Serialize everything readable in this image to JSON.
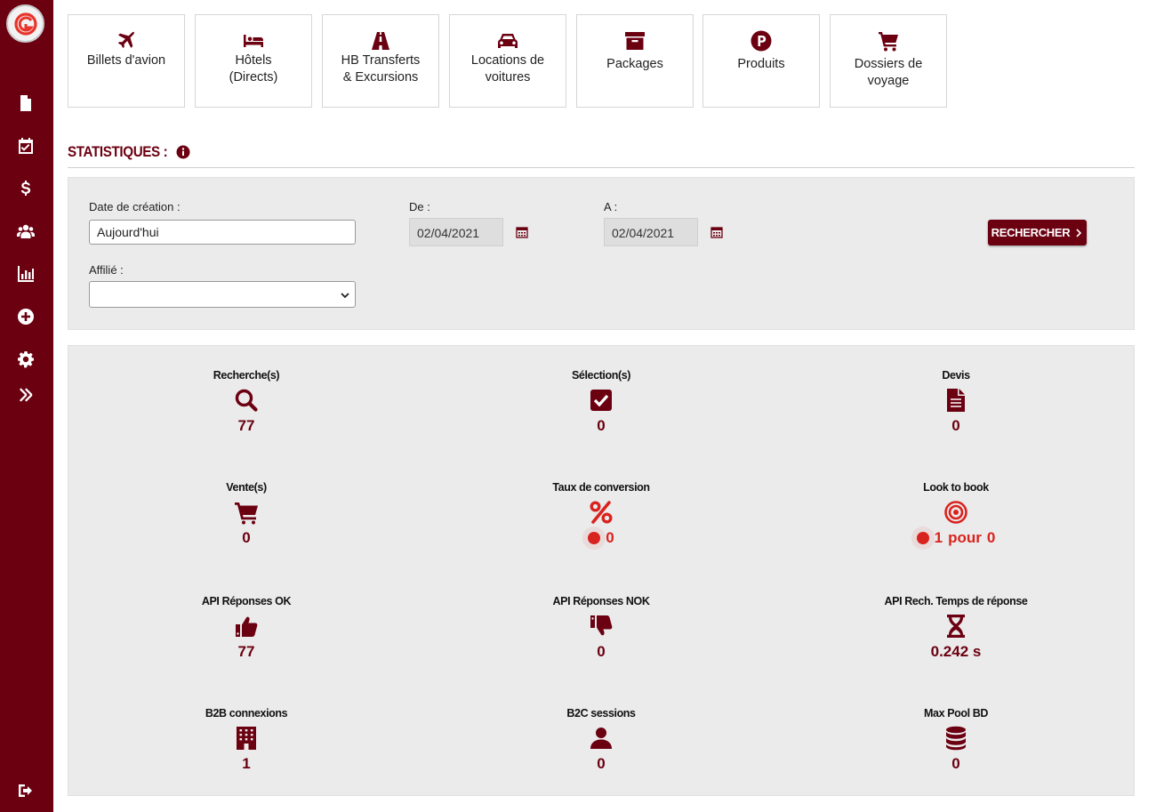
{
  "sidebar": {
    "icons": [
      "logo-icon",
      "document-icon",
      "calendar-check-icon",
      "dollar-icon",
      "users-icon",
      "bar-chart-icon",
      "plus-circle-icon",
      "gear-icon",
      "double-chevron-right-icon",
      "sign-out-icon"
    ]
  },
  "products": [
    {
      "label": "Billets d'avion",
      "icon": "plane-icon"
    },
    {
      "label": "Hôtels (Directs)",
      "icon": "bed-icon"
    },
    {
      "label": "HB Transferts & Excursions",
      "icon": "road-icon"
    },
    {
      "label": "Locations de voitures",
      "icon": "car-icon"
    },
    {
      "label": "Packages",
      "icon": "archive-box-icon"
    },
    {
      "label": "Produits",
      "icon": "parking-icon"
    },
    {
      "label": "Dossiers de voyage",
      "icon": "cart-icon"
    }
  ],
  "statistics": {
    "title": "STATISTIQUES :"
  },
  "filter": {
    "creation_date_label": "Date de création :",
    "creation_date_value": "Aujourd'hui",
    "from_label": "De :",
    "from_value": "02/04/2021",
    "to_label": "A :",
    "to_value": "02/04/2021",
    "affiliate_label": "Affilié :",
    "affiliate_value": "",
    "search_button": "RECHERCHER"
  },
  "stats": [
    {
      "label": "Recherche(s)",
      "value": "77",
      "icon": "search-icon"
    },
    {
      "label": "Sélection(s)",
      "value": "0",
      "icon": "check-square-icon"
    },
    {
      "label": "Devis",
      "value": "0",
      "icon": "file-text-icon"
    },
    {
      "label": "Vente(s)",
      "value": "0",
      "icon": "cart-icon"
    },
    {
      "label": "Taux de conversion",
      "value": "0",
      "icon": "percent-icon"
    },
    {
      "label": "Look to book",
      "value_a": "1",
      "value_sep": "pour",
      "value_b": "0",
      "icon": "target-icon"
    },
    {
      "label": "API Réponses OK",
      "value": "77",
      "icon": "thumbs-up-icon"
    },
    {
      "label": "API Réponses NOK",
      "value": "0",
      "icon": "thumbs-down-icon"
    },
    {
      "label": "API Rech. Temps de réponse",
      "value": "0.242 s",
      "icon": "hourglass-icon"
    },
    {
      "label": "B2B connexions",
      "value": "1",
      "icon": "building-icon"
    },
    {
      "label": "B2C sessions",
      "value": "0",
      "icon": "user-icon"
    },
    {
      "label": "Max Pool BD",
      "value": "0",
      "icon": "database-icon"
    }
  ],
  "colors": {
    "brand": "#6b0011",
    "alert": "#d9231e",
    "panel": "#ebebeb"
  }
}
